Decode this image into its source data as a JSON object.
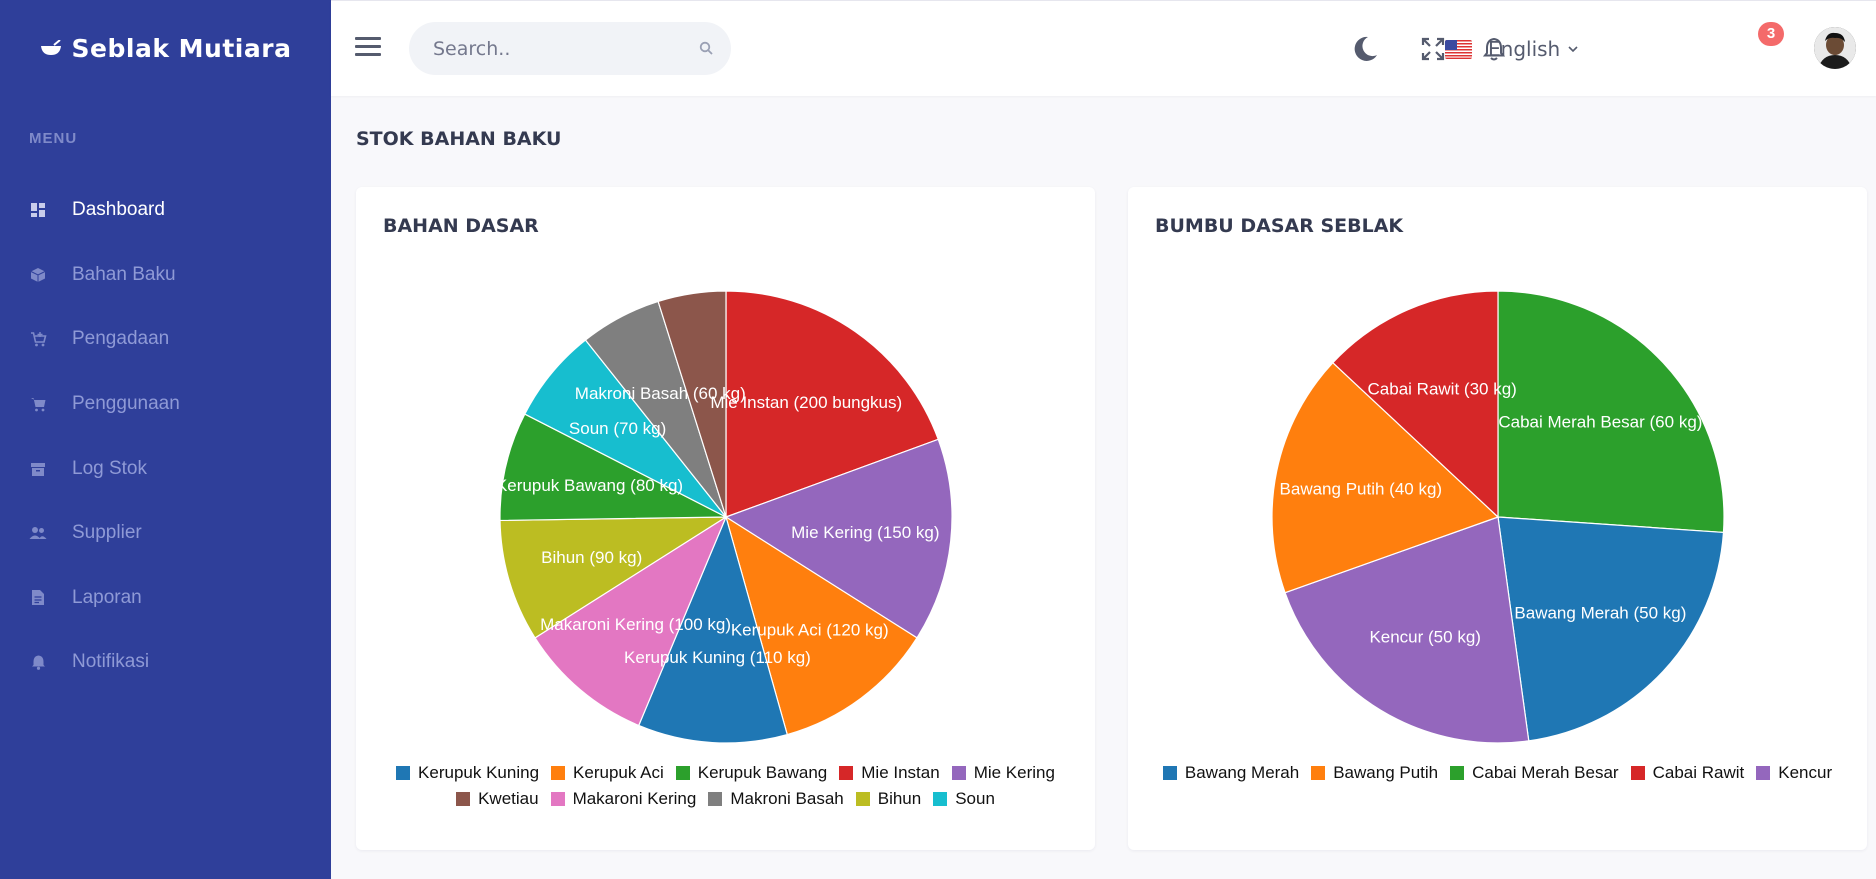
{
  "app": {
    "brand": "Seblak Mutiara"
  },
  "sidebar": {
    "menu_title": "MENU",
    "items": [
      {
        "label": "Dashboard",
        "icon": "dashboard-icon",
        "active": true
      },
      {
        "label": "Bahan Baku",
        "icon": "cube-icon"
      },
      {
        "label": "Pengadaan",
        "icon": "cart-plus-icon"
      },
      {
        "label": "Penggunaan",
        "icon": "cart-icon"
      },
      {
        "label": "Log Stok",
        "icon": "archive-icon"
      },
      {
        "label": "Supplier",
        "icon": "users-icon"
      },
      {
        "label": "Laporan",
        "icon": "file-icon"
      },
      {
        "label": "Notifikasi",
        "icon": "bell-icon"
      }
    ]
  },
  "topbar": {
    "search_placeholder": "Search..",
    "language": "English",
    "notification_count": "3"
  },
  "page": {
    "title": "STOK BAHAN BAKU"
  },
  "colors": {
    "sidebar": "#2f3f9a",
    "blue": "#1f77b4",
    "orange": "#ff7f0e",
    "green": "#2ca02c",
    "red": "#d62728",
    "purple": "#9467bd",
    "brown": "#8c564b",
    "pink": "#e377c2",
    "gray": "#7f7f7f",
    "olive": "#bcbd22",
    "cyan": "#17becf"
  },
  "chart_data": [
    {
      "type": "pie",
      "title": "BAHAN DASAR",
      "categories": [
        "Kerupuk Kuning",
        "Kerupuk Aci",
        "Kerupuk Bawang",
        "Mie Instan",
        "Mie Kering",
        "Kwetiau",
        "Makaroni Kering",
        "Makroni Basah",
        "Bihun",
        "Soun"
      ],
      "slice_order": [
        "Mie Instan",
        "Mie Kering",
        "Kerupuk Aci",
        "Kerupuk Kuning",
        "Makaroni Kering",
        "Bihun",
        "Kerupuk Bawang",
        "Soun",
        "Makroni Basah",
        "Kwetiau"
      ],
      "values": {
        "Mie Instan": 200,
        "Mie Kering": 150,
        "Kerupuk Aci": 120,
        "Kerupuk Kuning": 110,
        "Makaroni Kering": 100,
        "Bihun": 90,
        "Kerupuk Bawang": 80,
        "Soun": 70,
        "Makroni Basah": 60,
        "Kwetiau": 50
      },
      "labels": {
        "Mie Instan": "Mie Instan (200 bungkus)",
        "Mie Kering": "Mie Kering (150 kg)",
        "Kerupuk Aci": "Kerupuk Aci (120 kg)",
        "Kerupuk Kuning": "Kerupuk Kuning (110 kg)",
        "Makaroni Kering": "Makaroni Kering (100 kg)",
        "Bihun": "Bihun (90 kg)",
        "Kerupuk Bawang": "Kerupuk Bawang (80 kg)",
        "Soun": "Soun (70 kg)",
        "Makroni Basah": "Makroni Basah (60 kg)",
        "Kwetiau": ""
      },
      "colors": {
        "Kerupuk Kuning": "#1f77b4",
        "Kerupuk Aci": "#ff7f0e",
        "Kerupuk Bawang": "#2ca02c",
        "Mie Instan": "#d62728",
        "Mie Kering": "#9467bd",
        "Kwetiau": "#8c564b",
        "Makaroni Kering": "#e377c2",
        "Makroni Basah": "#7f7f7f",
        "Bihun": "#bcbd22",
        "Soun": "#17becf"
      },
      "legend": "bottom"
    },
    {
      "type": "pie",
      "title": "BUMBU DASAR SEBLAK",
      "categories": [
        "Bawang Merah",
        "Bawang Putih",
        "Cabai Merah Besar",
        "Cabai Rawit",
        "Kencur"
      ],
      "slice_order": [
        "Cabai Merah Besar",
        "Bawang Merah",
        "Kencur",
        "Bawang Putih",
        "Cabai Rawit"
      ],
      "values": {
        "Cabai Merah Besar": 60,
        "Bawang Merah": 50,
        "Kencur": 50,
        "Bawang Putih": 40,
        "Cabai Rawit": 30
      },
      "labels": {
        "Cabai Merah Besar": "Cabai Merah Besar (60 kg)",
        "Bawang Merah": "Bawang Merah (50 kg)",
        "Kencur": "Kencur (50 kg)",
        "Bawang Putih": "Bawang Putih (40 kg)",
        "Cabai Rawit": "Cabai Rawit (30 kg)"
      },
      "colors": {
        "Bawang Merah": "#1f77b4",
        "Bawang Putih": "#ff7f0e",
        "Cabai Merah Besar": "#2ca02c",
        "Cabai Rawit": "#d62728",
        "Kencur": "#9467bd"
      },
      "legend": "bottom"
    }
  ]
}
